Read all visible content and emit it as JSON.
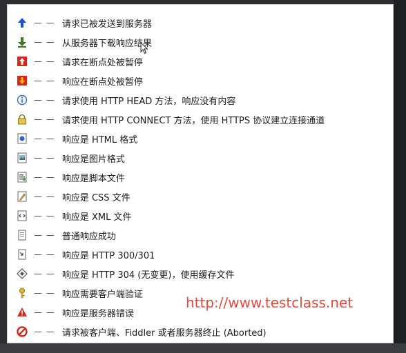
{
  "legend": {
    "items": [
      {
        "icon": "up-arrow-icon",
        "label": "请求已被发送到服务器"
      },
      {
        "icon": "down-arrow-icon",
        "label": "从服务器下载响应结果"
      },
      {
        "icon": "request-breakpoint-icon",
        "label": "请求在断点处被暂停"
      },
      {
        "icon": "response-breakpoint-icon",
        "label": "响应在断点处被暂停"
      },
      {
        "icon": "info-icon",
        "label": "请求使用 HTTP HEAD 方法，响应没有内容"
      },
      {
        "icon": "lock-icon",
        "label": "请求使用 HTTP CONNECT 方法，使用 HTTPS 协议建立连接通道"
      },
      {
        "icon": "html-file-icon",
        "label": "响应是 HTML 格式"
      },
      {
        "icon": "image-file-icon",
        "label": "响应是图片格式"
      },
      {
        "icon": "script-file-icon",
        "label": "响应是脚本文件"
      },
      {
        "icon": "css-file-icon",
        "label": "响应是 CSS 文件"
      },
      {
        "icon": "xml-file-icon",
        "label": "响应是 XML 文件"
      },
      {
        "icon": "generic-file-icon",
        "label": "普通响应成功"
      },
      {
        "icon": "redirect-file-icon",
        "label": "响应是 HTTP 300/301"
      },
      {
        "icon": "cache-icon",
        "label": "响应是 HTTP 304 (无变更)，使用缓存文件"
      },
      {
        "icon": "key-icon",
        "label": "响应需要客户端验证"
      },
      {
        "icon": "warning-icon",
        "label": "响应是服务器错误"
      },
      {
        "icon": "aborted-icon",
        "label": "请求被客户端、Fiddler 或者服务器终止 (Aborted)"
      }
    ],
    "dash": "— —"
  },
  "watermark": "http://www.testclass.net",
  "colors": {
    "watermark": "#e34a3a",
    "up_arrow": "#1f4fd6",
    "down_arrow": "#3f7a1e",
    "error_red": "#d8261c"
  }
}
